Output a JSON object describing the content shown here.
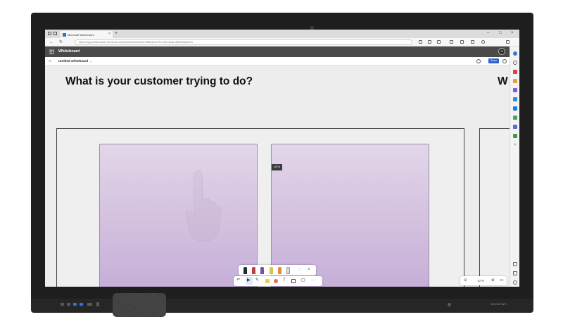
{
  "browser": {
    "tab_title": "Microsoft Whiteboard",
    "tab_close": "×",
    "new_tab": "+",
    "url": "https://app.whiteboard.microsoft.com/me/whiteboards/b7f4f64ab-679e-4f1b-8bac-df93d3ae2fc7b",
    "window_controls": {
      "minimize": "–",
      "maximize": "□",
      "close": "×"
    },
    "nav": {
      "back": "←",
      "refresh": "↻"
    }
  },
  "app": {
    "name": "Whiteboard",
    "avatar_initials": "JA",
    "doc_title": "Untitled whiteboard",
    "doc_chevron": "⌄",
    "home_icon": "⌂",
    "share_label": "Share"
  },
  "canvas": {
    "heading": "What is your customer trying to do?",
    "heading_right": "W",
    "zoom_tooltip": "107%"
  },
  "pen_tray": {
    "pen_colors": [
      "#2b2b2b",
      "#c23b4a",
      "#7a4fa6",
      "#d7c24a",
      "#e48a3a",
      "#d9d9d9"
    ],
    "lasso_icon": "◌",
    "close_icon": "×"
  },
  "toolbar": {
    "undo": "↶",
    "select": "▶",
    "pen": "✎",
    "note": "▢",
    "text": "T",
    "more": "···"
  },
  "zoom": {
    "level": "107%",
    "zoom_out": "⊖",
    "zoom_in": "⊕",
    "fit": "▭"
  },
  "colors": {
    "note_top": "#e2d6e8",
    "note_bottom": "#c6aed8",
    "share_blue": "#2a62d6",
    "header_gray": "#4b4b4b"
  },
  "device": {
    "brand": "WINDOWS"
  }
}
